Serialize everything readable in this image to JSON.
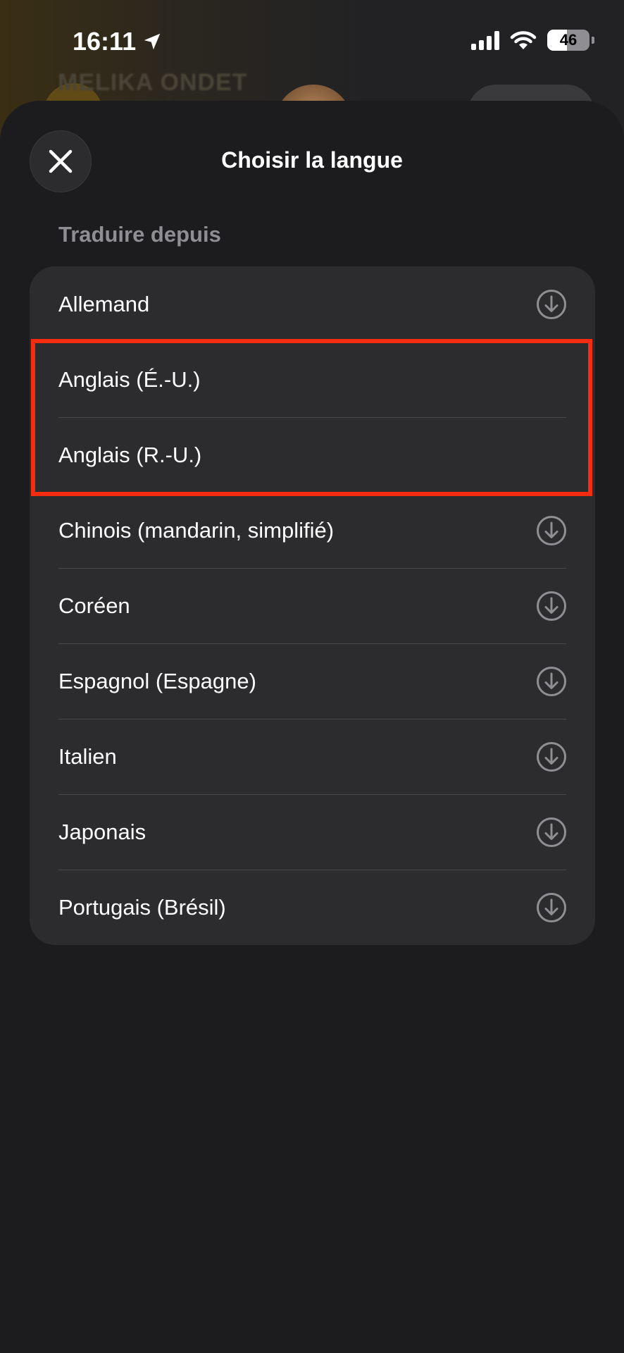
{
  "status_bar": {
    "time": "16:11",
    "battery_level": "46",
    "battery_fraction": 0.46,
    "icons": [
      "location-arrow-icon",
      "cellular-signal-icon",
      "wifi-icon",
      "battery-icon"
    ]
  },
  "background_app": {
    "contact_name": "MELIKA ONDET"
  },
  "sheet": {
    "title": "Choisir la langue",
    "close_icon": "close-icon",
    "section_header": "Traduire depuis",
    "languages": [
      {
        "label": "Allemand",
        "downloadable": true
      },
      {
        "label": "Anglais (É.-U.)",
        "downloadable": false
      },
      {
        "label": "Anglais (R.-U.)",
        "downloadable": false
      },
      {
        "label": "Chinois (mandarin, simplifié)",
        "downloadable": true
      },
      {
        "label": "Coréen",
        "downloadable": true
      },
      {
        "label": "Espagnol (Espagne)",
        "downloadable": true
      },
      {
        "label": "Italien",
        "downloadable": true
      },
      {
        "label": "Japonais",
        "downloadable": true
      },
      {
        "label": "Portugais (Brésil)",
        "downloadable": true
      }
    ]
  },
  "colors": {
    "sheet_background": "#1c1c1e",
    "list_background": "#2c2c2e",
    "separator": "#48484a",
    "secondary_text": "#8e8e93",
    "highlight": "#f52c10"
  }
}
